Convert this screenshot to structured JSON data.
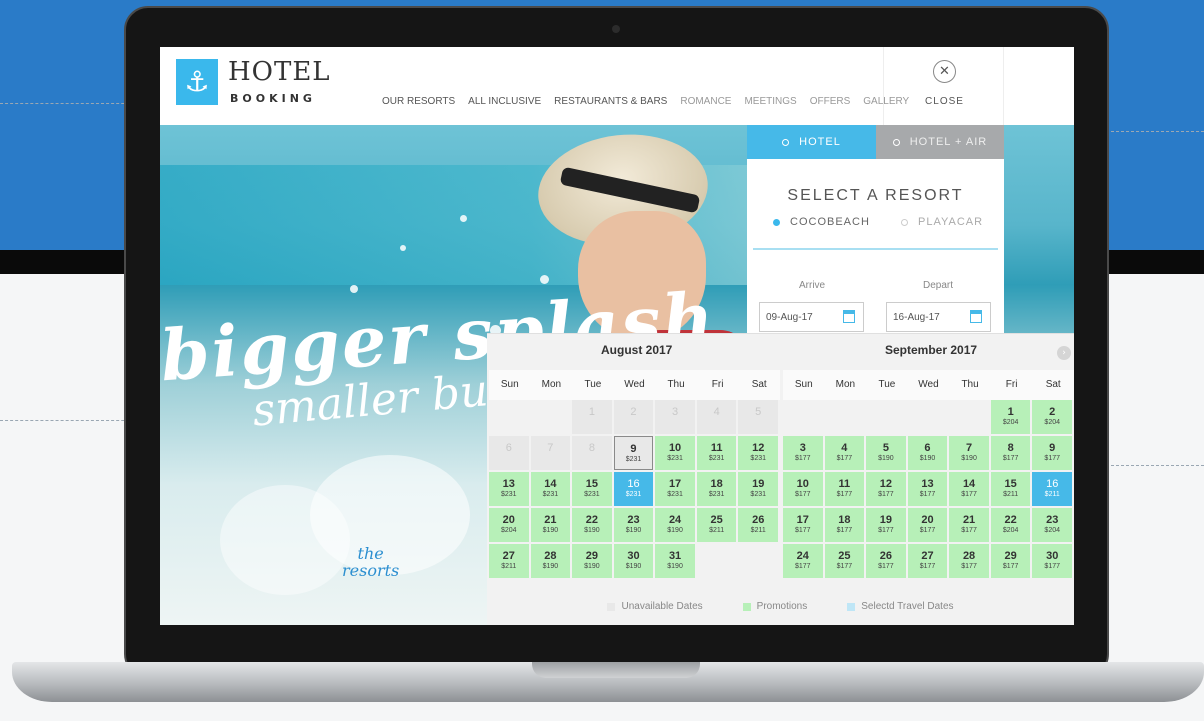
{
  "header": {
    "logo_icon": "anchor-icon",
    "logo_title": "HOTEL",
    "logo_subtitle": "BOOKING",
    "nav": [
      "OUR RESORTS",
      "ALL INCLUSIVE",
      "RESTAURANTS & BARS",
      "ROMANCE",
      "MEETINGS",
      "OFFERS",
      "GALLERY"
    ],
    "close_icon": "close-icon",
    "close_label": "CLOSE"
  },
  "hero": {
    "headline": "bigger splash",
    "subheadline": "smaller budget",
    "brand_line1": "the",
    "brand_line2": "resorts"
  },
  "booking": {
    "tab_hotel": "HOTEL",
    "tab_hotel_air": "HOTEL + AIR",
    "select_title": "SELECT A RESORT",
    "resort_1": "COCOBEACH",
    "resort_2": "PLAYACAR",
    "selected_resort": "COCOBEACH",
    "arrive_label": "Arrive",
    "depart_label": "Depart",
    "arrive_value": "09-Aug-17",
    "depart_value": "16-Aug-17",
    "calendar_icon": "calendar-icon"
  },
  "calendar": {
    "weekdays": [
      "Sun",
      "Mon",
      "Tue",
      "Wed",
      "Thu",
      "Fri",
      "Sat"
    ],
    "next_icon": "chevron-right-icon",
    "months": [
      {
        "title": "August 2017",
        "lead_blanks": 2,
        "days": [
          {
            "d": "1",
            "s": "unavail"
          },
          {
            "d": "2",
            "s": "unavail"
          },
          {
            "d": "3",
            "s": "unavail"
          },
          {
            "d": "4",
            "s": "unavail"
          },
          {
            "d": "5",
            "s": "unavail"
          },
          {
            "d": "6",
            "s": "unavail"
          },
          {
            "d": "7",
            "s": "unavail"
          },
          {
            "d": "8",
            "s": "unavail"
          },
          {
            "d": "9",
            "p": "$231",
            "s": "outline"
          },
          {
            "d": "10",
            "p": "$231",
            "s": "promo"
          },
          {
            "d": "11",
            "p": "$231",
            "s": "promo"
          },
          {
            "d": "12",
            "p": "$231",
            "s": "promo"
          },
          {
            "d": "13",
            "p": "$231",
            "s": "promo"
          },
          {
            "d": "14",
            "p": "$231",
            "s": "promo"
          },
          {
            "d": "15",
            "p": "$231",
            "s": "promo"
          },
          {
            "d": "16",
            "p": "$231",
            "s": "sel"
          },
          {
            "d": "17",
            "p": "$231",
            "s": "promo"
          },
          {
            "d": "18",
            "p": "$231",
            "s": "promo"
          },
          {
            "d": "19",
            "p": "$231",
            "s": "promo"
          },
          {
            "d": "20",
            "p": "$204",
            "s": "promo"
          },
          {
            "d": "21",
            "p": "$190",
            "s": "promo"
          },
          {
            "d": "22",
            "p": "$190",
            "s": "promo"
          },
          {
            "d": "23",
            "p": "$190",
            "s": "promo"
          },
          {
            "d": "24",
            "p": "$190",
            "s": "promo"
          },
          {
            "d": "25",
            "p": "$211",
            "s": "promo"
          },
          {
            "d": "26",
            "p": "$211",
            "s": "promo"
          },
          {
            "d": "27",
            "p": "$211",
            "s": "promo"
          },
          {
            "d": "28",
            "p": "$190",
            "s": "promo"
          },
          {
            "d": "29",
            "p": "$190",
            "s": "promo"
          },
          {
            "d": "30",
            "p": "$190",
            "s": "promo"
          },
          {
            "d": "31",
            "p": "$190",
            "s": "promo"
          }
        ]
      },
      {
        "title": "September 2017",
        "lead_blanks": 5,
        "days": [
          {
            "d": "1",
            "p": "$204",
            "s": "promo"
          },
          {
            "d": "2",
            "p": "$204",
            "s": "promo"
          },
          {
            "d": "3",
            "p": "$177",
            "s": "promo"
          },
          {
            "d": "4",
            "p": "$177",
            "s": "promo"
          },
          {
            "d": "5",
            "p": "$190",
            "s": "promo"
          },
          {
            "d": "6",
            "p": "$190",
            "s": "promo"
          },
          {
            "d": "7",
            "p": "$190",
            "s": "promo"
          },
          {
            "d": "8",
            "p": "$177",
            "s": "promo"
          },
          {
            "d": "9",
            "p": "$177",
            "s": "promo"
          },
          {
            "d": "10",
            "p": "$177",
            "s": "promo"
          },
          {
            "d": "11",
            "p": "$177",
            "s": "promo"
          },
          {
            "d": "12",
            "p": "$177",
            "s": "promo"
          },
          {
            "d": "13",
            "p": "$177",
            "s": "promo"
          },
          {
            "d": "14",
            "p": "$177",
            "s": "promo"
          },
          {
            "d": "15",
            "p": "$211",
            "s": "promo"
          },
          {
            "d": "16",
            "p": "$211",
            "s": "sel"
          },
          {
            "d": "17",
            "p": "$177",
            "s": "promo"
          },
          {
            "d": "18",
            "p": "$177",
            "s": "promo"
          },
          {
            "d": "19",
            "p": "$177",
            "s": "promo"
          },
          {
            "d": "20",
            "p": "$177",
            "s": "promo"
          },
          {
            "d": "21",
            "p": "$177",
            "s": "promo"
          },
          {
            "d": "22",
            "p": "$204",
            "s": "promo"
          },
          {
            "d": "23",
            "p": "$204",
            "s": "promo"
          },
          {
            "d": "24",
            "p": "$177",
            "s": "promo"
          },
          {
            "d": "25",
            "p": "$177",
            "s": "promo"
          },
          {
            "d": "26",
            "p": "$177",
            "s": "promo"
          },
          {
            "d": "27",
            "p": "$177",
            "s": "promo"
          },
          {
            "d": "28",
            "p": "$177",
            "s": "promo"
          },
          {
            "d": "29",
            "p": "$177",
            "s": "promo"
          },
          {
            "d": "30",
            "p": "$177",
            "s": "promo"
          }
        ]
      }
    ],
    "legend": {
      "unavailable": "Unavailable Dates",
      "promotions": "Promotions",
      "selected": "Selectd Travel Dates"
    }
  },
  "colors": {
    "accent": "#46b9e8",
    "promo": "#b7f0b8",
    "unavailable": "#e8e8e8",
    "page_blue": "#2a7bc8"
  }
}
